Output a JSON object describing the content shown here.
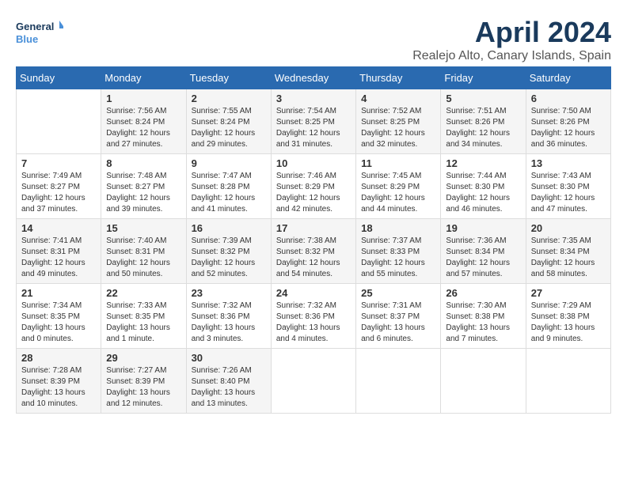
{
  "logo": {
    "line1": "General",
    "line2": "Blue"
  },
  "title": "April 2024",
  "subtitle": "Realejo Alto, Canary Islands, Spain",
  "days_of_week": [
    "Sunday",
    "Monday",
    "Tuesday",
    "Wednesday",
    "Thursday",
    "Friday",
    "Saturday"
  ],
  "weeks": [
    [
      {
        "day": "",
        "sunrise": "",
        "sunset": "",
        "daylight": ""
      },
      {
        "day": "1",
        "sunrise": "Sunrise: 7:56 AM",
        "sunset": "Sunset: 8:24 PM",
        "daylight": "Daylight: 12 hours and 27 minutes."
      },
      {
        "day": "2",
        "sunrise": "Sunrise: 7:55 AM",
        "sunset": "Sunset: 8:24 PM",
        "daylight": "Daylight: 12 hours and 29 minutes."
      },
      {
        "day": "3",
        "sunrise": "Sunrise: 7:54 AM",
        "sunset": "Sunset: 8:25 PM",
        "daylight": "Daylight: 12 hours and 31 minutes."
      },
      {
        "day": "4",
        "sunrise": "Sunrise: 7:52 AM",
        "sunset": "Sunset: 8:25 PM",
        "daylight": "Daylight: 12 hours and 32 minutes."
      },
      {
        "day": "5",
        "sunrise": "Sunrise: 7:51 AM",
        "sunset": "Sunset: 8:26 PM",
        "daylight": "Daylight: 12 hours and 34 minutes."
      },
      {
        "day": "6",
        "sunrise": "Sunrise: 7:50 AM",
        "sunset": "Sunset: 8:26 PM",
        "daylight": "Daylight: 12 hours and 36 minutes."
      }
    ],
    [
      {
        "day": "7",
        "sunrise": "Sunrise: 7:49 AM",
        "sunset": "Sunset: 8:27 PM",
        "daylight": "Daylight: 12 hours and 37 minutes."
      },
      {
        "day": "8",
        "sunrise": "Sunrise: 7:48 AM",
        "sunset": "Sunset: 8:27 PM",
        "daylight": "Daylight: 12 hours and 39 minutes."
      },
      {
        "day": "9",
        "sunrise": "Sunrise: 7:47 AM",
        "sunset": "Sunset: 8:28 PM",
        "daylight": "Daylight: 12 hours and 41 minutes."
      },
      {
        "day": "10",
        "sunrise": "Sunrise: 7:46 AM",
        "sunset": "Sunset: 8:29 PM",
        "daylight": "Daylight: 12 hours and 42 minutes."
      },
      {
        "day": "11",
        "sunrise": "Sunrise: 7:45 AM",
        "sunset": "Sunset: 8:29 PM",
        "daylight": "Daylight: 12 hours and 44 minutes."
      },
      {
        "day": "12",
        "sunrise": "Sunrise: 7:44 AM",
        "sunset": "Sunset: 8:30 PM",
        "daylight": "Daylight: 12 hours and 46 minutes."
      },
      {
        "day": "13",
        "sunrise": "Sunrise: 7:43 AM",
        "sunset": "Sunset: 8:30 PM",
        "daylight": "Daylight: 12 hours and 47 minutes."
      }
    ],
    [
      {
        "day": "14",
        "sunrise": "Sunrise: 7:41 AM",
        "sunset": "Sunset: 8:31 PM",
        "daylight": "Daylight: 12 hours and 49 minutes."
      },
      {
        "day": "15",
        "sunrise": "Sunrise: 7:40 AM",
        "sunset": "Sunset: 8:31 PM",
        "daylight": "Daylight: 12 hours and 50 minutes."
      },
      {
        "day": "16",
        "sunrise": "Sunrise: 7:39 AM",
        "sunset": "Sunset: 8:32 PM",
        "daylight": "Daylight: 12 hours and 52 minutes."
      },
      {
        "day": "17",
        "sunrise": "Sunrise: 7:38 AM",
        "sunset": "Sunset: 8:32 PM",
        "daylight": "Daylight: 12 hours and 54 minutes."
      },
      {
        "day": "18",
        "sunrise": "Sunrise: 7:37 AM",
        "sunset": "Sunset: 8:33 PM",
        "daylight": "Daylight: 12 hours and 55 minutes."
      },
      {
        "day": "19",
        "sunrise": "Sunrise: 7:36 AM",
        "sunset": "Sunset: 8:34 PM",
        "daylight": "Daylight: 12 hours and 57 minutes."
      },
      {
        "day": "20",
        "sunrise": "Sunrise: 7:35 AM",
        "sunset": "Sunset: 8:34 PM",
        "daylight": "Daylight: 12 hours and 58 minutes."
      }
    ],
    [
      {
        "day": "21",
        "sunrise": "Sunrise: 7:34 AM",
        "sunset": "Sunset: 8:35 PM",
        "daylight": "Daylight: 13 hours and 0 minutes."
      },
      {
        "day": "22",
        "sunrise": "Sunrise: 7:33 AM",
        "sunset": "Sunset: 8:35 PM",
        "daylight": "Daylight: 13 hours and 1 minute."
      },
      {
        "day": "23",
        "sunrise": "Sunrise: 7:32 AM",
        "sunset": "Sunset: 8:36 PM",
        "daylight": "Daylight: 13 hours and 3 minutes."
      },
      {
        "day": "24",
        "sunrise": "Sunrise: 7:32 AM",
        "sunset": "Sunset: 8:36 PM",
        "daylight": "Daylight: 13 hours and 4 minutes."
      },
      {
        "day": "25",
        "sunrise": "Sunrise: 7:31 AM",
        "sunset": "Sunset: 8:37 PM",
        "daylight": "Daylight: 13 hours and 6 minutes."
      },
      {
        "day": "26",
        "sunrise": "Sunrise: 7:30 AM",
        "sunset": "Sunset: 8:38 PM",
        "daylight": "Daylight: 13 hours and 7 minutes."
      },
      {
        "day": "27",
        "sunrise": "Sunrise: 7:29 AM",
        "sunset": "Sunset: 8:38 PM",
        "daylight": "Daylight: 13 hours and 9 minutes."
      }
    ],
    [
      {
        "day": "28",
        "sunrise": "Sunrise: 7:28 AM",
        "sunset": "Sunset: 8:39 PM",
        "daylight": "Daylight: 13 hours and 10 minutes."
      },
      {
        "day": "29",
        "sunrise": "Sunrise: 7:27 AM",
        "sunset": "Sunset: 8:39 PM",
        "daylight": "Daylight: 13 hours and 12 minutes."
      },
      {
        "day": "30",
        "sunrise": "Sunrise: 7:26 AM",
        "sunset": "Sunset: 8:40 PM",
        "daylight": "Daylight: 13 hours and 13 minutes."
      },
      {
        "day": "",
        "sunrise": "",
        "sunset": "",
        "daylight": ""
      },
      {
        "day": "",
        "sunrise": "",
        "sunset": "",
        "daylight": ""
      },
      {
        "day": "",
        "sunrise": "",
        "sunset": "",
        "daylight": ""
      },
      {
        "day": "",
        "sunrise": "",
        "sunset": "",
        "daylight": ""
      }
    ]
  ]
}
